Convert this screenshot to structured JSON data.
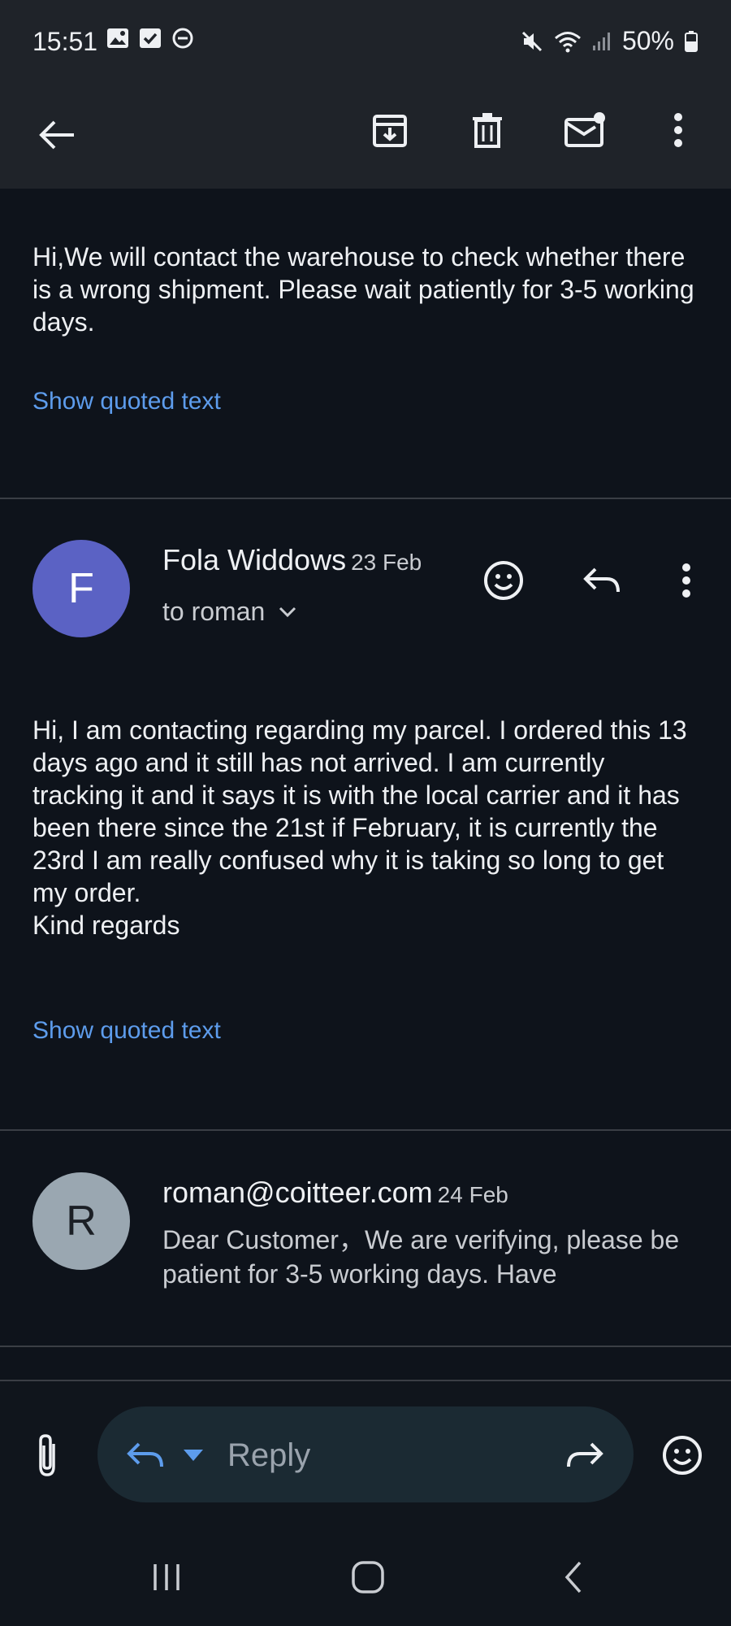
{
  "status_bar": {
    "time": "15:51",
    "battery": "50%",
    "left_icons": [
      "gallery-icon",
      "checkbox-icon",
      "dnd-icon"
    ],
    "right_icons": [
      "mute-icon",
      "wifi-icon",
      "signal-icon",
      "battery-icon"
    ]
  },
  "toolbar": {
    "actions": [
      "back-arrow-icon",
      "archive-icon",
      "delete-icon",
      "mark-unread-icon",
      "more-options-icon"
    ]
  },
  "thread": {
    "first_message": {
      "body": "Hi,We will contact the warehouse to check whether there is a wrong shipment. Please wait patiently for 3-5 working days.",
      "show_quoted": "Show quoted text"
    },
    "second_message": {
      "avatar_letter": "F",
      "avatar_color": "#5b62c4",
      "sender": "Fola Widdows",
      "date": "23 Feb",
      "to": "to roman",
      "body": "Hi, I am contacting regarding my parcel. I ordered this 13 days ago and it still has not arrived. I am currently tracking it and it says it is with the local carrier and it has been there since the 21st if February, it is currently the 23rd I am really confused why it is taking so long to get my order.\nKind regards",
      "show_quoted": "Show quoted text"
    },
    "third_message": {
      "avatar_letter": "R",
      "avatar_color": "#9aa7b1",
      "sender": "roman@coitteer.com",
      "date": "24 Feb",
      "snippet": "Dear Customer，We are verifying, please be patient for 3-5 working days. Have"
    }
  },
  "composer": {
    "placeholder": "Reply",
    "accent": "#5d9cec"
  }
}
